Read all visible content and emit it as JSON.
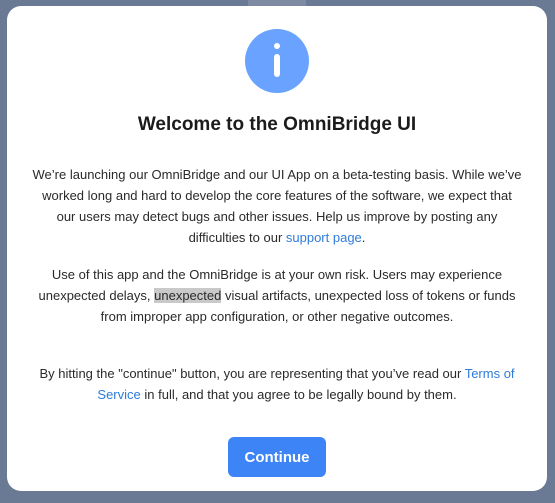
{
  "dialog": {
    "title": "Welcome to the OmniBridge UI",
    "icon": "info-icon",
    "accent_color": "#6aa3ff",
    "paragraph1": {
      "text": "We’re launching our OmniBridge and our UI App on a beta-testing basis. While we’ve worked long and hard to develop the core features of the software, we expect that our users may detect bugs and other issues. Help us improve by posting any difficulties to our ",
      "link": "support page",
      "after": "."
    },
    "paragraph2": {
      "before": "Use of this app and the OmniBridge is at your own risk. Users may experience unexpected delays, ",
      "highlight": "unexpected",
      "after": " visual artifacts, unexpected loss of tokens or funds from improper app configuration, or other negative outcomes."
    },
    "paragraph3": {
      "before": "By hitting the \"continue\" button, you are representing that you’ve read our ",
      "link": "Terms of Service",
      "after": " in full, and that you agree to be legally bound by them."
    },
    "continue_label": "Continue",
    "button_color": "#3d84f7",
    "link_color": "#2f7bd9"
  }
}
